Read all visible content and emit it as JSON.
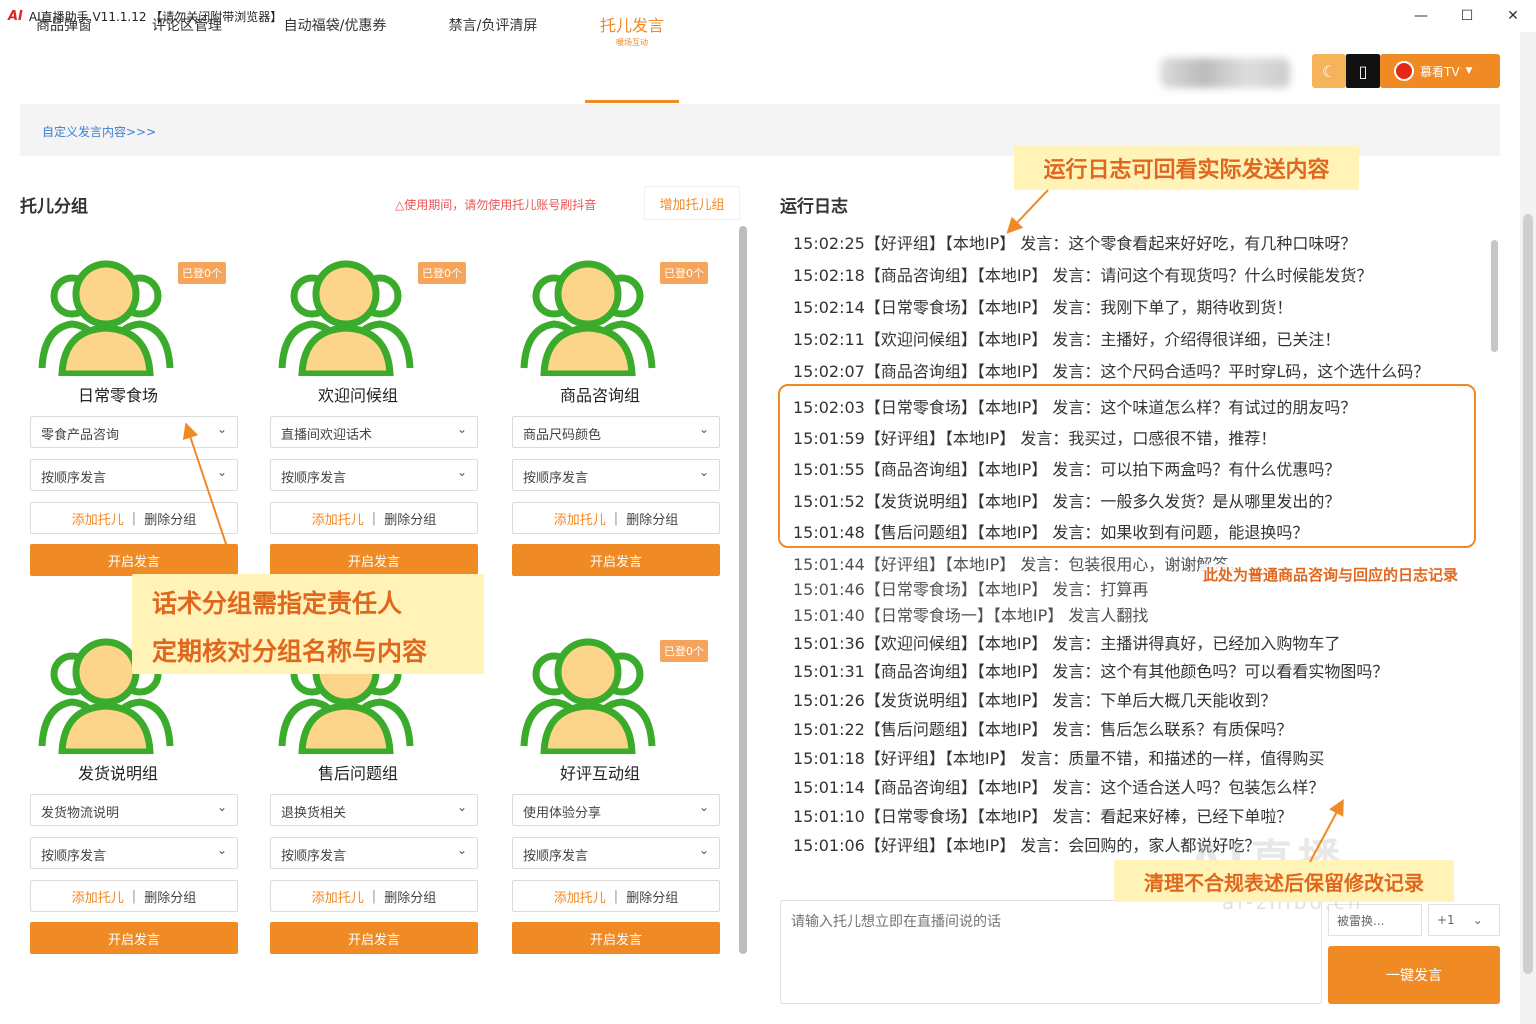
{
  "window": {
    "logo": "AI",
    "title": "AI直播助手 V11.1.12 【请勿关闭附带浏览器】",
    "minimize": "—",
    "maximize": "☐",
    "close": "✕"
  },
  "nav": {
    "tabs": [
      {
        "label": "商品弹窗"
      },
      {
        "label": "评论区管理"
      },
      {
        "label": "自动福袋/优惠券"
      },
      {
        "label": "禁言/负评清屏"
      },
      {
        "label": "托儿发言",
        "sub": "暖场互动"
      }
    ]
  },
  "toolbar": {
    "tv_label": "慕看TV",
    "tv_caret": "▼"
  },
  "custom_link": "自定义发言内容>>>",
  "left": {
    "title": "托儿分组",
    "warning": "△使用期间，请勿使用托儿账号刷抖音",
    "add_group": "增加托儿组"
  },
  "cards": [
    {
      "name": "日常零食场",
      "badge": "已登0个",
      "select1": "零食产品咨询",
      "select2": "按顺序发言",
      "add": "添加托儿",
      "sep": "|",
      "del": "删除分组",
      "start": "开启发言"
    },
    {
      "name": "欢迎问候组",
      "badge": "已登0个",
      "select1": "直播间欢迎话术",
      "select2": "按顺序发言",
      "add": "添加托儿",
      "sep": "|",
      "del": "删除分组",
      "start": "开启发言"
    },
    {
      "name": "商品咨询组",
      "badge": "已登0个",
      "select1": "商品尺码颜色",
      "select2": "按顺序发言",
      "add": "添加托儿",
      "sep": "|",
      "del": "删除分组",
      "start": "开启发言"
    },
    {
      "name": "发货说明组",
      "badge": "",
      "select1": "发货物流说明",
      "select2": "按顺序发言",
      "add": "添加托儿",
      "sep": "|",
      "del": "删除分组",
      "start": "开启发言"
    },
    {
      "name": "售后问题组",
      "badge": "",
      "select1": "退换货相关",
      "select2": "按顺序发言",
      "add": "添加托儿",
      "sep": "|",
      "del": "删除分组",
      "start": "开启发言"
    },
    {
      "name": "好评互动组",
      "badge": "已登0个",
      "select1": "使用体验分享",
      "select2": "按顺序发言",
      "add": "添加托儿",
      "sep": "|",
      "del": "删除分组",
      "start": "开启发言"
    }
  ],
  "log": {
    "title": "运行日志",
    "lines": [
      "15:02:25【好评组】【本地IP】 发言：这个零食看起来好好吃，有几种口味呀？",
      "15:02:18【商品咨询组】【本地IP】 发言：请问这个有现货吗？什么时候能发货？",
      "15:02:14【日常零食场】【本地IP】 发言：我刚下单了，期待收到货！",
      "15:02:11【欢迎问候组】【本地IP】 发言：主播好，介绍得很详细，已关注！",
      "15:02:07【商品咨询组】【本地IP】 发言：这个尺码合适吗？平时穿L码，这个选什么码？",
      "15:02:03【日常零食场】【本地IP】 发言：这个味道怎么样？有试过的朋友吗？",
      "15:01:59【好评组】【本地IP】 发言：我买过，口感很不错，推荐！",
      "15:01:55【商品咨询组】【本地IP】 发言：可以拍下两盒吗？有什么优惠吗？",
      "15:01:52【发货说明组】【本地IP】 发言：一般多久发货？是从哪里发出的？",
      "15:01:48【售后问题组】【本地IP】 发言：如果收到有问题，能退换吗？",
      "15:01:44【好评组】【本地IP】 发言：包装很用心，谢谢解答，",
      "15:01:46【日常零食场】【本地IP】 发言：打算再",
      "15:01:40【日常零食场一】【本地IP】 发言人翻找",
      "15:01:36【欢迎问候组】【本地IP】 发言：主播讲得真好，已经加入购物车了",
      "15:01:31【商品咨询组】【本地IP】 发言：这个有其他颜色吗？可以看看实物图吗？",
      "15:01:26【发货说明组】【本地IP】 发言：下单后大概几天能收到？",
      "15:01:22【售后问题组】【本地IP】 发言：售后怎么联系？有质保吗？",
      "15:01:18【好评组】【本地IP】 发言：质量不错，和描述的一样，值得购买",
      "15:01:14【商品咨询组】【本地IP】 发言：这个适合送人吗？包装怎么样？",
      "15:01:10【日常零食场】【本地IP】 发言：看起来好棒，已经下单啦？",
      "15:01:06【好评组】【本地IP】 发言：会回购的，家人都说好吃？"
    ]
  },
  "input": {
    "placeholder": "请输入托儿想立即在直播间说的话",
    "select_person": "被雷换...",
    "select_count": "+1",
    "count_caret": "⌄",
    "send": "一键发言"
  },
  "annotations": {
    "log_review": "运行日志可回看实际发送内容",
    "group_owner_line1": "话术分组需指定责任人",
    "group_owner_line2": "定期核对分组名称与内容",
    "normal_log": "此处为普通商品咨询与回应的日志记录",
    "keep_record": "清理不合规表述后保留修改记录"
  },
  "watermark": {
    "main": "AI直播",
    "sub": "ai-zhibo.cn"
  },
  "colors": {
    "accent": "#f08a24",
    "avatar_green": "#3aab2a",
    "avatar_face": "#fcd58a",
    "warning": "#e75656",
    "link": "#3b7fd4"
  }
}
